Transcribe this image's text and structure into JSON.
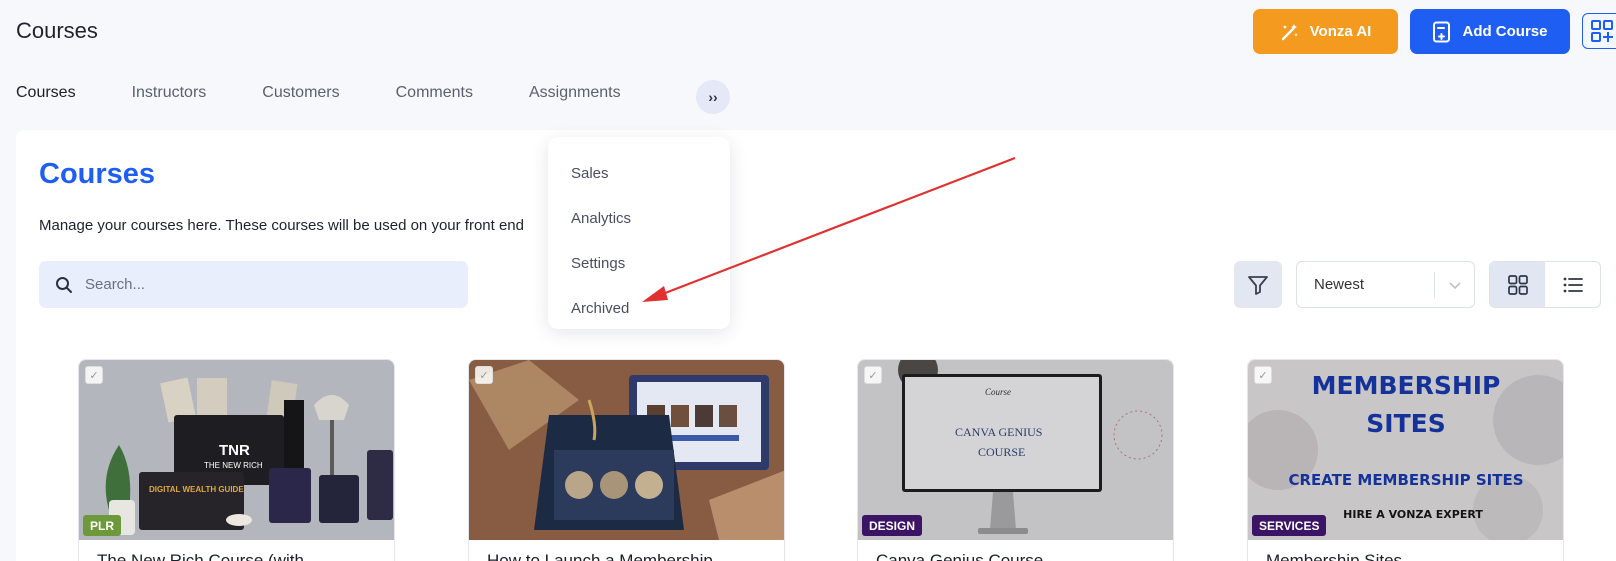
{
  "header": {
    "title": "Courses",
    "vonza_ai_label": "Vonza AI",
    "add_course_label": "Add Course"
  },
  "tabs": [
    {
      "label": "Courses",
      "active": true
    },
    {
      "label": "Instructors"
    },
    {
      "label": "Customers"
    },
    {
      "label": "Comments"
    },
    {
      "label": "Assignments"
    }
  ],
  "tab_more_label": "››",
  "more_menu": [
    "Sales",
    "Analytics",
    "Settings",
    "Archived"
  ],
  "panel": {
    "heading": "Courses",
    "description": "Manage your courses here. These courses will be used on your front end"
  },
  "search": {
    "placeholder": "Search..."
  },
  "sort": {
    "selected": "Newest"
  },
  "cards": [
    {
      "badge": "PLR",
      "badge_color": "#6c9a3a",
      "title": "The New Rich Course (with",
      "image_text_1": "TNR",
      "image_text_2": "THE NEW RICH",
      "image_text_3": "DIGITAL WEALTH GUIDE"
    },
    {
      "title": "How to Launch a Membership"
    },
    {
      "badge": "DESIGN",
      "badge_color": "#3b1466",
      "title": "Canva Genius Course",
      "image_text_1": "Course",
      "image_text_2": "CANVA GENIUS",
      "image_text_3": "COURSE"
    },
    {
      "badge": "SERVICES",
      "badge_color": "#3b1466",
      "title": "Membership Sites",
      "image_text_1": "MEMBERSHIP",
      "image_text_2": "SITES",
      "image_text_3": "CREATE MEMBERSHIP SITES",
      "image_text_4": "HIRE A VONZA EXPERT"
    }
  ],
  "colors": {
    "primary": "#1f5ef3",
    "ai_button": "#f39a1f",
    "annotation_arrow": "#e0302f"
  }
}
